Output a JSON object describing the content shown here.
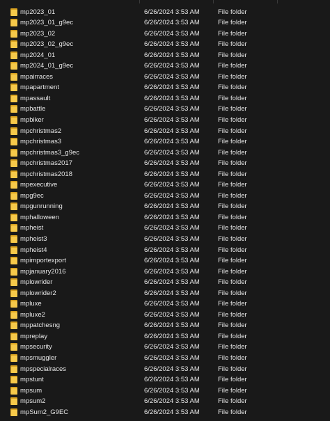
{
  "file_list": {
    "rows": [
      {
        "name": "mp2023_01",
        "date_modified": "6/26/2024 3:53 AM",
        "type": "File folder"
      },
      {
        "name": "mp2023_01_g9ec",
        "date_modified": "6/26/2024 3:53 AM",
        "type": "File folder"
      },
      {
        "name": "mp2023_02",
        "date_modified": "6/26/2024 3:53 AM",
        "type": "File folder"
      },
      {
        "name": "mp2023_02_g9ec",
        "date_modified": "6/26/2024 3:53 AM",
        "type": "File folder"
      },
      {
        "name": "mp2024_01",
        "date_modified": "6/26/2024 3:53 AM",
        "type": "File folder"
      },
      {
        "name": "mp2024_01_g9ec",
        "date_modified": "6/26/2024 3:53 AM",
        "type": "File folder"
      },
      {
        "name": "mpairraces",
        "date_modified": "6/26/2024 3:53 AM",
        "type": "File folder"
      },
      {
        "name": "mpapartment",
        "date_modified": "6/26/2024 3:53 AM",
        "type": "File folder"
      },
      {
        "name": "mpassault",
        "date_modified": "6/26/2024 3:53 AM",
        "type": "File folder"
      },
      {
        "name": "mpbattle",
        "date_modified": "6/26/2024 3:53 AM",
        "type": "File folder"
      },
      {
        "name": "mpbiker",
        "date_modified": "6/26/2024 3:53 AM",
        "type": "File folder"
      },
      {
        "name": "mpchristmas2",
        "date_modified": "6/26/2024 3:53 AM",
        "type": "File folder"
      },
      {
        "name": "mpchristmas3",
        "date_modified": "6/26/2024 3:53 AM",
        "type": "File folder"
      },
      {
        "name": "mpchristmas3_g9ec",
        "date_modified": "6/26/2024 3:53 AM",
        "type": "File folder"
      },
      {
        "name": "mpchristmas2017",
        "date_modified": "6/26/2024 3:53 AM",
        "type": "File folder"
      },
      {
        "name": "mpchristmas2018",
        "date_modified": "6/26/2024 3:53 AM",
        "type": "File folder"
      },
      {
        "name": "mpexecutive",
        "date_modified": "6/26/2024 3:53 AM",
        "type": "File folder"
      },
      {
        "name": "mpg9ec",
        "date_modified": "6/26/2024 3:53 AM",
        "type": "File folder"
      },
      {
        "name": "mpgunrunning",
        "date_modified": "6/26/2024 3:53 AM",
        "type": "File folder"
      },
      {
        "name": "mphalloween",
        "date_modified": "6/26/2024 3:53 AM",
        "type": "File folder"
      },
      {
        "name": "mpheist",
        "date_modified": "6/26/2024 3:53 AM",
        "type": "File folder"
      },
      {
        "name": "mpheist3",
        "date_modified": "6/26/2024 3:53 AM",
        "type": "File folder"
      },
      {
        "name": "mpheist4",
        "date_modified": "6/26/2024 3:53 AM",
        "type": "File folder"
      },
      {
        "name": "mpimportexport",
        "date_modified": "6/26/2024 3:53 AM",
        "type": "File folder"
      },
      {
        "name": "mpjanuary2016",
        "date_modified": "6/26/2024 3:53 AM",
        "type": "File folder"
      },
      {
        "name": "mplowrider",
        "date_modified": "6/26/2024 3:53 AM",
        "type": "File folder"
      },
      {
        "name": "mplowrider2",
        "date_modified": "6/26/2024 3:53 AM",
        "type": "File folder"
      },
      {
        "name": "mpluxe",
        "date_modified": "6/26/2024 3:53 AM",
        "type": "File folder"
      },
      {
        "name": "mpluxe2",
        "date_modified": "6/26/2024 3:53 AM",
        "type": "File folder"
      },
      {
        "name": "mppatchesng",
        "date_modified": "6/26/2024 3:53 AM",
        "type": "File folder"
      },
      {
        "name": "mpreplay",
        "date_modified": "6/26/2024 3:53 AM",
        "type": "File folder"
      },
      {
        "name": "mpsecurity",
        "date_modified": "6/26/2024 3:53 AM",
        "type": "File folder"
      },
      {
        "name": "mpsmuggler",
        "date_modified": "6/26/2024 3:53 AM",
        "type": "File folder"
      },
      {
        "name": "mpspecialraces",
        "date_modified": "6/26/2024 3:53 AM",
        "type": "File folder"
      },
      {
        "name": "mpstunt",
        "date_modified": "6/26/2024 3:53 AM",
        "type": "File folder"
      },
      {
        "name": "mpsum",
        "date_modified": "6/26/2024 3:53 AM",
        "type": "File folder"
      },
      {
        "name": "mpsum2",
        "date_modified": "6/26/2024 3:53 AM",
        "type": "File folder"
      },
      {
        "name": "mpSum2_G9EC",
        "date_modified": "6/26/2024 3:53 AM",
        "type": "File folder"
      }
    ]
  },
  "colors": {
    "background": "#191919",
    "text": "#e6e6e6",
    "folder_front": "#f6c94a",
    "folder_back": "#d9a21f"
  },
  "icons": {
    "row_icon": "folder-icon"
  }
}
